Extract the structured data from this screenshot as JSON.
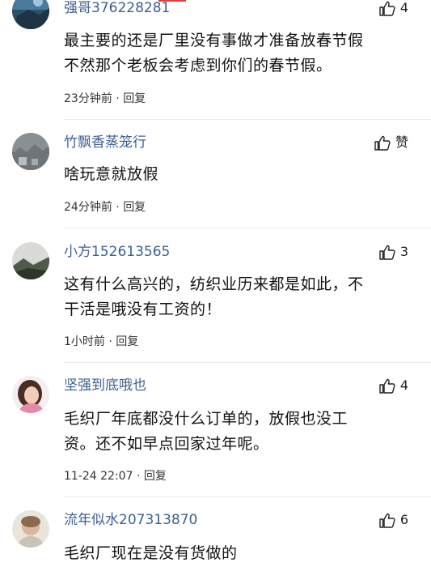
{
  "comments": [
    {
      "username": "强哥376228281",
      "likes": "4",
      "lines": [
        "最主要的还是厂里没有事做才准备放春节假",
        "不然那个老板会考虑到你们的春节假。"
      ],
      "time": "23分钟前",
      "reply": "回复"
    },
    {
      "username": "竹飘香蒸笼行",
      "likes": "赞",
      "lines": [
        "啥玩意就放假"
      ],
      "time": "24分钟前",
      "reply": "回复"
    },
    {
      "username": "小方152613565",
      "likes": "3",
      "lines": [
        "这有什么高兴的，纺织业历来都是如此，不",
        "干活是哦没有工资的！"
      ],
      "time": "1小时前",
      "reply": "回复"
    },
    {
      "username": "坚强到底哦也",
      "likes": "4",
      "lines": [
        "毛织厂年底都没什么订单的，放假也没工",
        "资。还不如早点回家过年呢。"
      ],
      "time": "11-24 22:07",
      "reply": "回复"
    },
    {
      "username": "流年似水207313870",
      "likes": "6",
      "lines": [
        "毛织厂现在是没有货做的"
      ],
      "time": "",
      "reply": ""
    }
  ],
  "separator": "·",
  "colors": {
    "username": "#3d5f8f",
    "text": "#111111",
    "meta": "#333333",
    "divider": "#ececec"
  },
  "icons": {
    "like": "thumbs-up-icon",
    "avatar": "avatar"
  }
}
